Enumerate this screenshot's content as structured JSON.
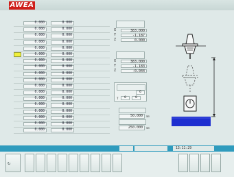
{
  "header": {
    "logo": "AWEA",
    "title_line1": "",
    "title_line2": ""
  },
  "table": {
    "headers": [
      "",
      "",
      "",
      ""
    ],
    "selected_row": 5,
    "rows": [
      [
        "0.000",
        "0.000",
        ""
      ],
      [
        "0.000",
        "0.000",
        ""
      ],
      [
        "0.000",
        "0.000",
        ""
      ],
      [
        "0.000",
        "0.000",
        ""
      ],
      [
        "0.000",
        "0.000",
        ""
      ],
      [
        "0.000",
        "0.000",
        ""
      ],
      [
        "0.000",
        "0.000",
        ""
      ],
      [
        "0.000",
        "0.000",
        ""
      ],
      [
        "0.000",
        "0.000",
        ""
      ],
      [
        "0.000",
        "0.000",
        ""
      ],
      [
        "0.000",
        "0.000",
        ""
      ],
      [
        "0.000",
        "0.000",
        ""
      ],
      [
        "0.000",
        "0.000",
        ""
      ],
      [
        "0.000",
        "0.000",
        ""
      ],
      [
        "0.000",
        "0.000",
        ""
      ],
      [
        "0.000",
        "0.000",
        ""
      ],
      [
        "0.000",
        "0.000",
        ""
      ],
      [
        "0.000",
        "0.000",
        ""
      ]
    ]
  },
  "abs_coords": {
    "title": "",
    "axes": [
      {
        "axis": "X",
        "value": "383.000"
      },
      {
        "axis": "Y",
        "value": "-1.187"
      },
      {
        "axis": "Z",
        "value": "0.000"
      }
    ]
  },
  "mach_coords": {
    "title": "",
    "axes": [
      {
        "axis": "X",
        "value": "383.000"
      },
      {
        "axis": "Y",
        "value": "-1.183"
      },
      {
        "axis": "Z",
        "value": "-0.044"
      }
    ]
  },
  "tool_info": {
    "title": "",
    "sp_label": "",
    "sp_value": "6",
    "t_label": "T",
    "t_values": [
      "0",
      "0"
    ]
  },
  "settings": {
    "label1": "",
    "value1": "50.000",
    "unit1": "mm",
    "label2": "",
    "value2": "250.000",
    "unit2": "mm"
  },
  "diagram": {
    "side_label": ""
  },
  "status": {
    "seg1": "",
    "seg2": "",
    "time": "13:11:29"
  },
  "colors": {
    "logo": "#cf1f1a",
    "selected_row": "#f0f03a",
    "status_bar": "#2f9bbd",
    "table_blue": "#1e2fd0"
  }
}
